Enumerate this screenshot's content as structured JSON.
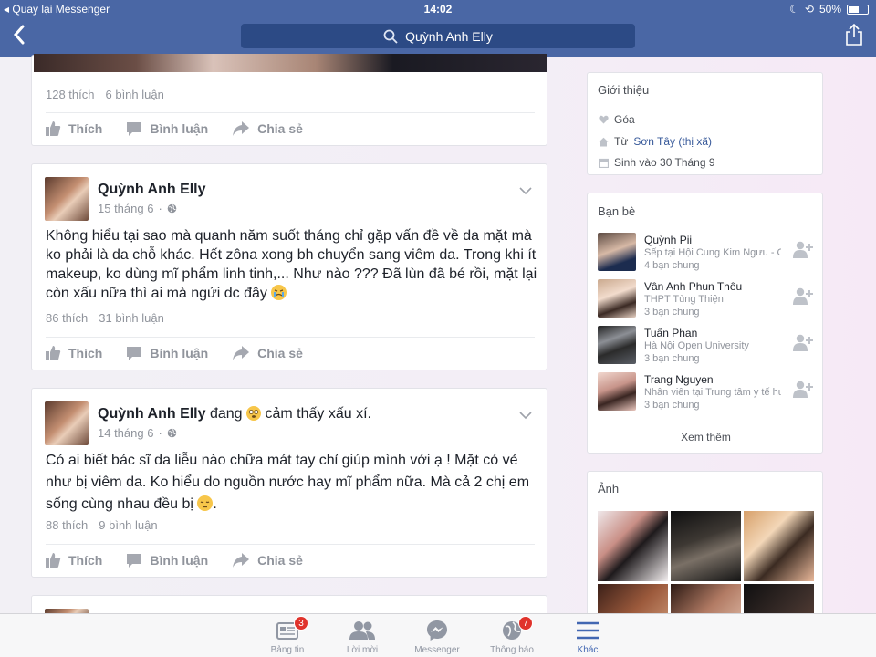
{
  "status": {
    "back_label": "Quay lại Messenger",
    "time": "14:02",
    "battery": "50%"
  },
  "nav": {
    "search_text": "Quỳnh Anh Elly"
  },
  "post0": {
    "likes": "128 thích",
    "comments": "6 bình luận"
  },
  "actions": {
    "like": "Thích",
    "comment": "Bình luận",
    "share": "Chia sẻ"
  },
  "post1": {
    "author": "Quỳnh Anh Elly",
    "time": "15 tháng 6",
    "text": "Không hiểu tại sao mà quanh năm suốt tháng chỉ gặp vấn đề về da mặt mà ko phải là da chỗ khác. Hết zôna xong bh chuyển sang viêm da. Trong khi ít makeup, ko dùng mĩ phẩm linh tinh,... Như nào ??? Đã lùn đã bé rồi, mặt lại còn xấu nữa thì ai mà ngửi dc đây",
    "likes": "86 thích",
    "comments": "31 bình luận"
  },
  "post2": {
    "author": "Quỳnh Anh Elly",
    "feeling_prefix": "đang",
    "feeling": "cảm thấy xấu xí.",
    "time": "14 tháng 6",
    "text": "Có ai biết bác sĩ da liễu nào chữa mát tay chỉ giúp mình với ạ ! Mặt có vẻ như bị viêm da. Ko hiểu do nguồn nước hay mĩ phẩm nữa. Mà cả 2 chị em sống cùng nhau đều bị",
    "text_end": ".",
    "likes": "88 thích",
    "comments": "9 bình luận"
  },
  "intro": {
    "title": "Giới thiệu",
    "status": "Góa",
    "from_prefix": "Từ",
    "from_place": "Sơn Tây (thị xã)",
    "birthday": "Sinh vào 30 Tháng 9"
  },
  "friends": {
    "title": "Bạn bè",
    "items": [
      {
        "name": "Quỳnh Pii",
        "sub": "Sếp tại Hội Cung Kim Ngưu - Cung Hoàng Đạo",
        "mutual": "4 bạn chung"
      },
      {
        "name": "Vân Anh Phun Thêu",
        "sub": "THPT Tùng Thiện",
        "mutual": "3 bạn chung"
      },
      {
        "name": "Tuấn Phan",
        "sub": "Hà Nội Open University",
        "mutual": "3 bạn chung"
      },
      {
        "name": "Trang Nguyen",
        "sub": "Nhân viên tại Trung tâm y tế huyện",
        "mutual": "3 bạn chung"
      }
    ],
    "see_more": "Xem thêm"
  },
  "photos": {
    "title": "Ảnh"
  },
  "tabbar": {
    "items": [
      {
        "label": "Bảng tin",
        "badge": "3"
      },
      {
        "label": "Lời mời",
        "badge": ""
      },
      {
        "label": "Messenger",
        "badge": ""
      },
      {
        "label": "Thông báo",
        "badge": "7"
      },
      {
        "label": "Khác",
        "badge": ""
      }
    ]
  },
  "colors": {
    "nav_blue": "#4a67a5",
    "active_tab": "#4267b2",
    "badge_red": "#e0332c",
    "link": "#365899"
  }
}
